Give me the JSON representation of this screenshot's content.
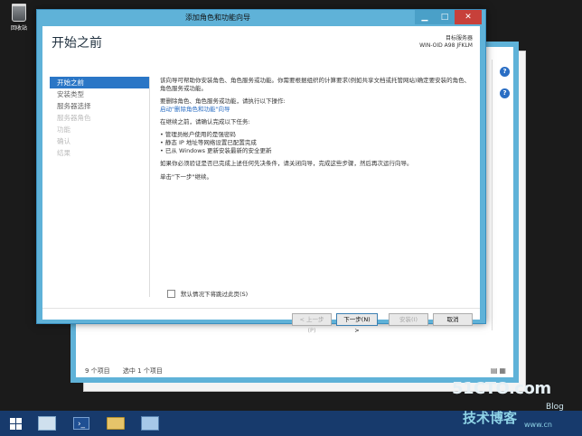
{
  "desktop": {
    "recycle_bin_label": "回收站"
  },
  "background_window": {
    "status_items": "9 个项目",
    "status_selected": "选中 1 个项目",
    "help_glyph": "?",
    "close_glyph": "✕"
  },
  "wizard": {
    "title": "添加角色和功能向导",
    "window_buttons": {
      "minimize": "▁",
      "maximize": "□",
      "close": "✕"
    },
    "page_title": "开始之前",
    "destination": {
      "label": "目标服务器",
      "server": "WIN-OID A98 JFKLM"
    },
    "nav": [
      {
        "label": "开始之前",
        "state": "active"
      },
      {
        "label": "安装类型",
        "state": "normal"
      },
      {
        "label": "服务器选择",
        "state": "normal"
      },
      {
        "label": "服务器角色",
        "state": "disabled"
      },
      {
        "label": "功能",
        "state": "disabled"
      },
      {
        "label": "确认",
        "state": "disabled"
      },
      {
        "label": "结果",
        "state": "disabled"
      }
    ],
    "content": {
      "intro": "该向导可帮助你安装角色、角色服务或功能。你需要根据组织的计算要求(例如共享文档或托管网站)确定要安装的角色、角色服务或功能。",
      "remove_text": "要删除角色、角色服务或功能，请执行以下操作:",
      "remove_link": "启动\"删除角色和功能\"向导",
      "verify_text": "在继续之前，请确认完成以下任务:",
      "bullets": [
        "管理员帐户使用的是强密码",
        "静态 IP 地址等网络设置已配置完成",
        "已从 Windows 更新安装最新的安全更新"
      ],
      "prereq_text": "如果你必须验证是否已完成上述任何先决条件，请关闭向导，完成这些步骤，然后再次运行向导。",
      "continue_text": "单击\"下一步\"继续。"
    },
    "skip_checkbox_label": "默认情况下将跳过此页(S)",
    "buttons": {
      "prev": "< 上一步(P)",
      "next": "下一步(N) >",
      "install": "安装(I)",
      "cancel": "取消"
    }
  },
  "taskbar": {
    "powershell_glyph": "›_"
  },
  "watermark": {
    "site": "51CTO.com",
    "tagline": "技术博客",
    "blog": "Blog",
    "url": "www.cn"
  }
}
